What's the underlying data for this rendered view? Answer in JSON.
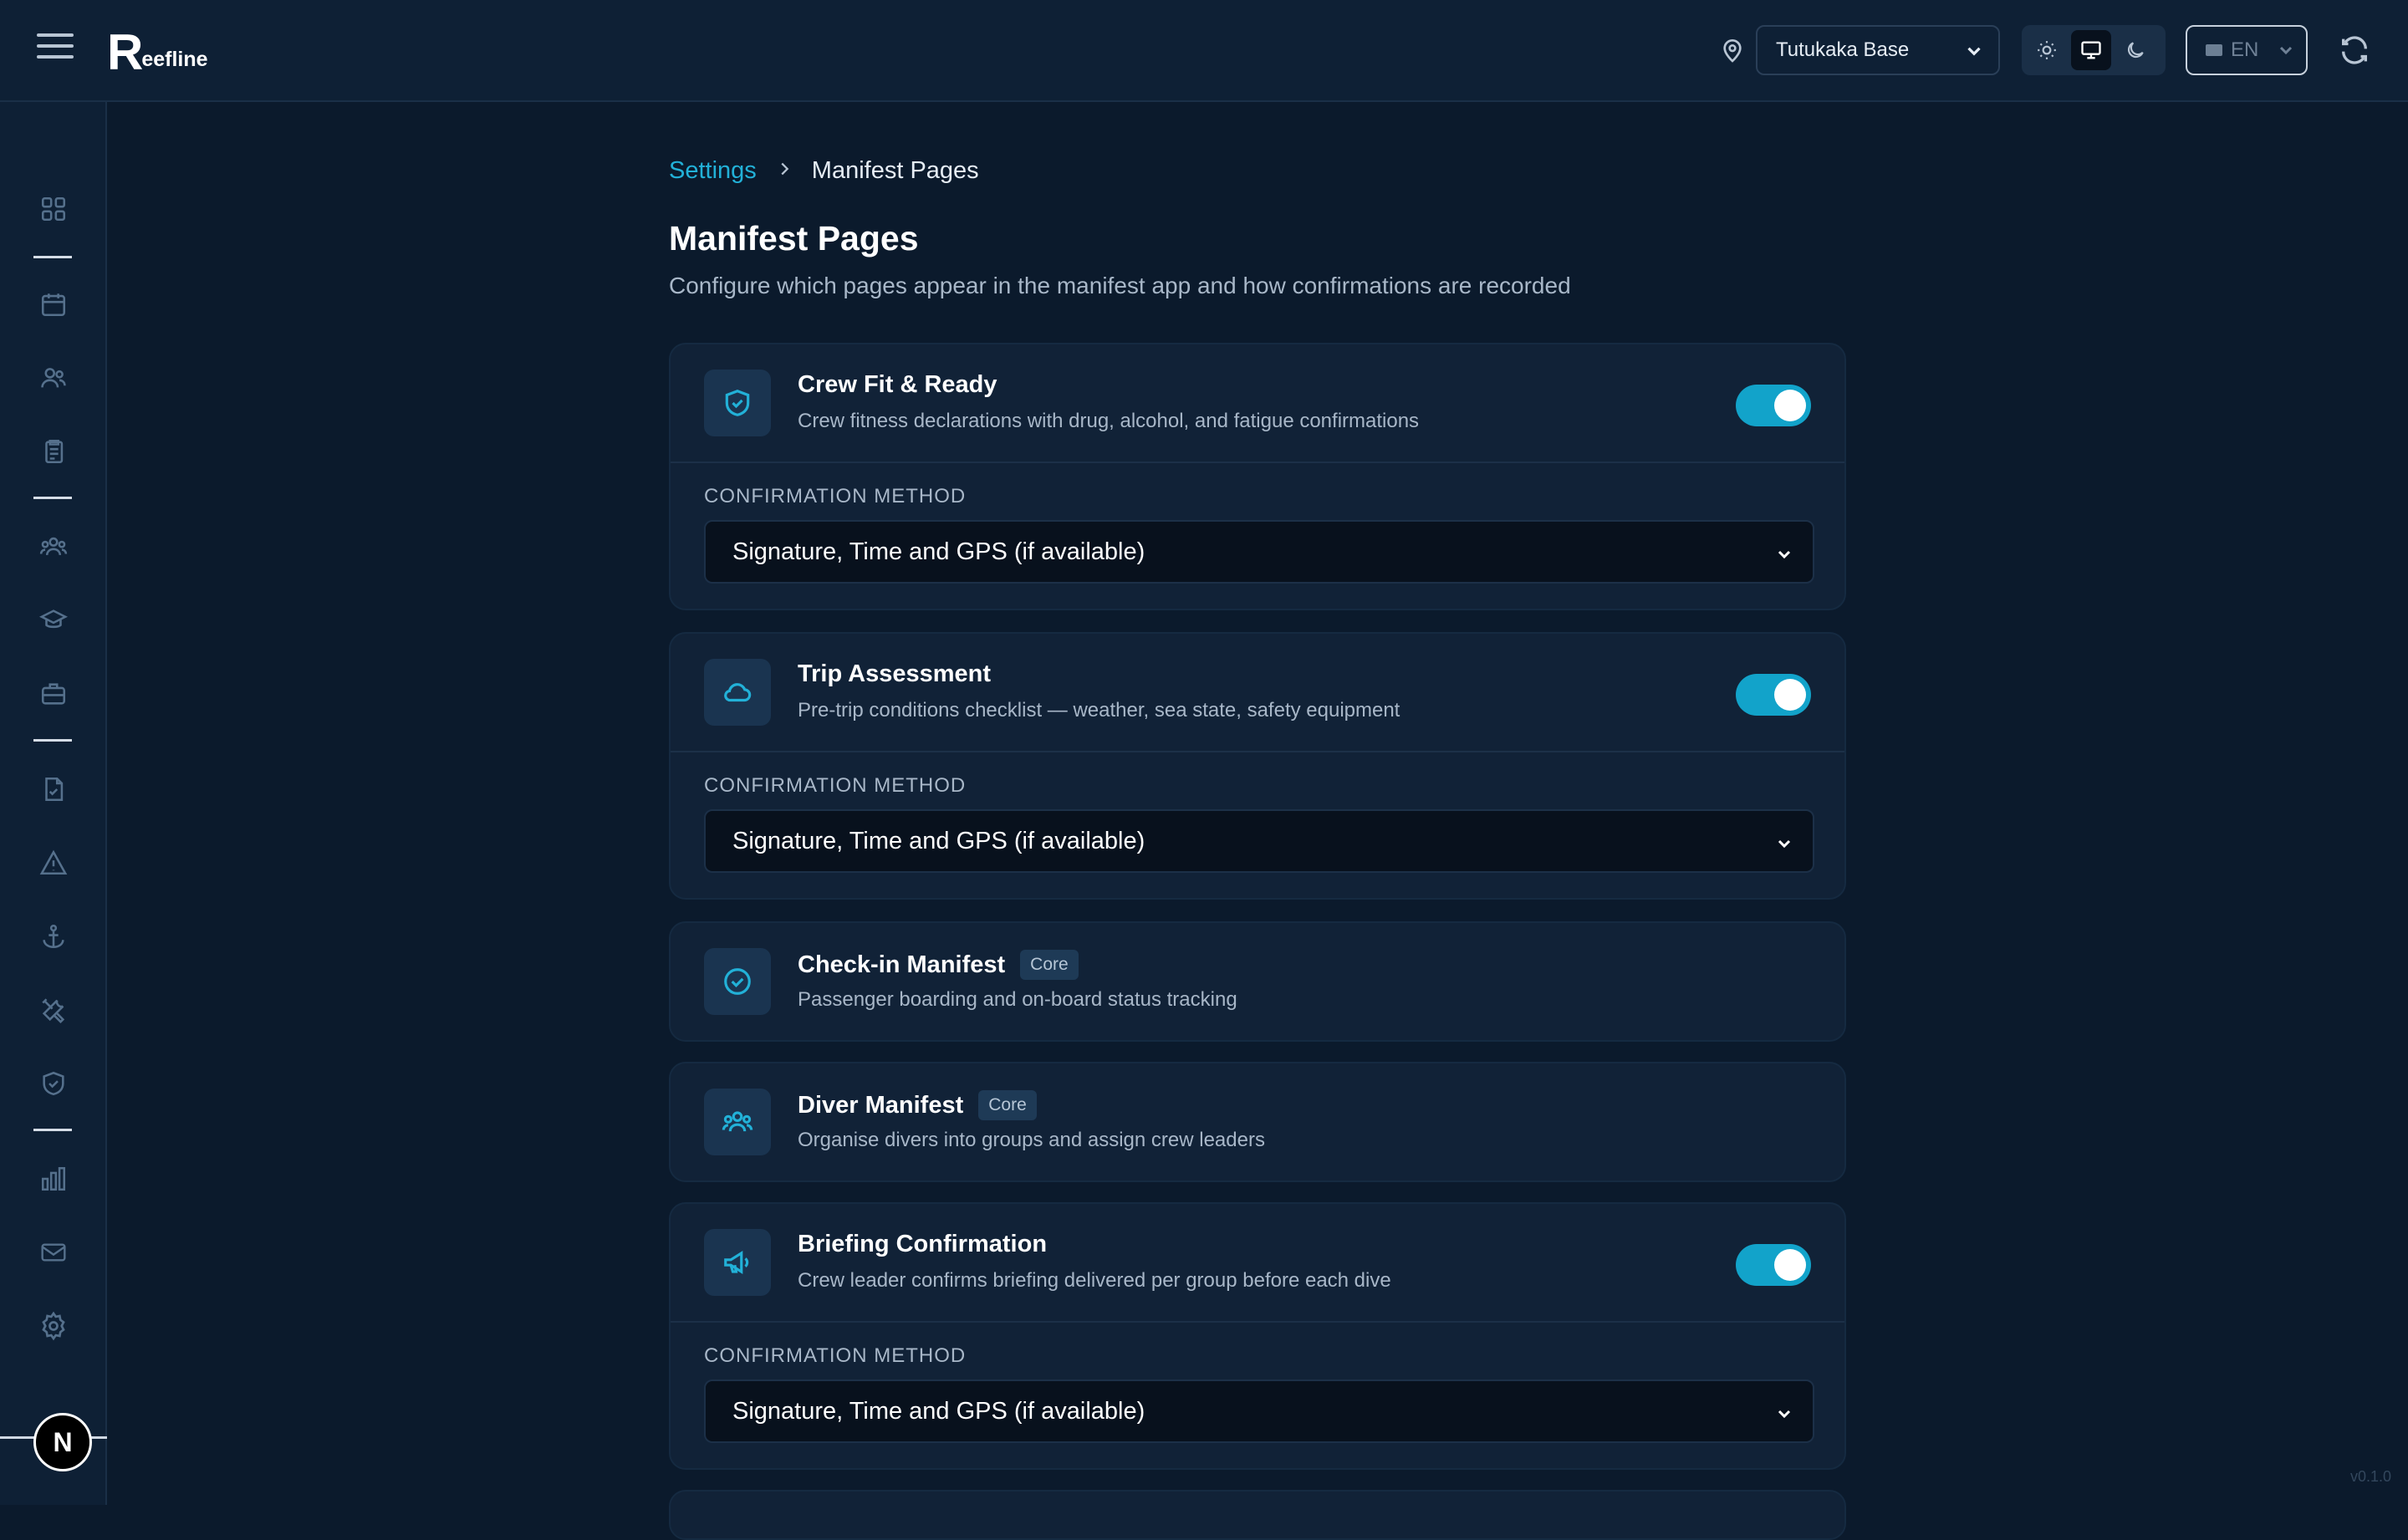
{
  "app": {
    "logo_letter": "R",
    "logo_rest": "eefline"
  },
  "header": {
    "location": "Tutukaka Base",
    "language": "EN"
  },
  "breadcrumb": {
    "parent": "Settings",
    "current": "Manifest Pages"
  },
  "page": {
    "title": "Manifest Pages",
    "subtitle": "Configure which pages appear in the manifest app and how confirmations are recorded"
  },
  "cards": [
    {
      "title": "Crew Fit & Ready",
      "description": "Crew fitness declarations with drug, alcohol, and fatigue confirmations",
      "method_label": "CONFIRMATION METHOD",
      "method_value": "Signature, Time and GPS (if available)",
      "enabled": true
    },
    {
      "title": "Trip Assessment",
      "description": "Pre-trip conditions checklist — weather, sea state, safety equipment",
      "method_label": "CONFIRMATION METHOD",
      "method_value": "Signature, Time and GPS (if available)",
      "enabled": true
    },
    {
      "title": "Check-in Manifest",
      "badge": "Core",
      "description": "Passenger boarding and on-board status tracking"
    },
    {
      "title": "Diver Manifest",
      "badge": "Core",
      "description": "Organise divers into groups and assign crew leaders"
    },
    {
      "title": "Briefing Confirmation",
      "description": "Crew leader confirms briefing delivered per group before each dive",
      "method_label": "CONFIRMATION METHOD",
      "method_value": "Signature, Time and GPS (if available)",
      "enabled": true
    }
  ],
  "footer": {
    "avatar_letter": "N",
    "version": "v0.1.0"
  },
  "colors": {
    "accent": "#22b1d8",
    "toggle_on": "#12a3ca",
    "background": "#0b1a2c",
    "card": "#112237"
  }
}
